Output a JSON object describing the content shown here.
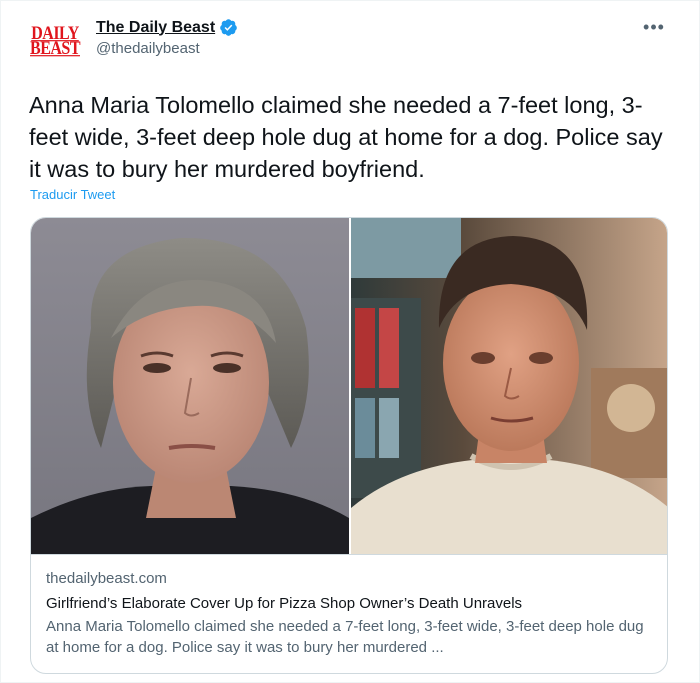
{
  "account": {
    "logo_line1": "DAILY",
    "logo_line2": "BEAST",
    "display_name": "The Daily Beast",
    "handle": "@thedailybeast",
    "verified": true
  },
  "menu": {
    "more_icon": "more-horizontal-icon",
    "more_glyph": "•••"
  },
  "tweet": {
    "text": "Anna Maria Tolomello claimed she needed a 7-feet long, 3-feet wide, 3-feet deep hole dug at home for a dog. Police say it was to bury her murdered boyfriend.",
    "translate_label": "Traducir Tweet"
  },
  "card": {
    "domain": "thedailybeast.com",
    "title": "Girlfriend’s Elaborate Cover Up for Pizza Shop Owner’s Death Unravels",
    "description": "Anna Maria Tolomello claimed she needed a 7-feet long, 3-feet wide, 3-feet deep hole dug at home for a dog. Police say it was to bury her murdered ..."
  },
  "colors": {
    "accent": "#1d9bf0",
    "brand_red": "#e0151d",
    "text_primary": "#0f1419",
    "text_secondary": "#536471",
    "border": "#cfd9de"
  }
}
